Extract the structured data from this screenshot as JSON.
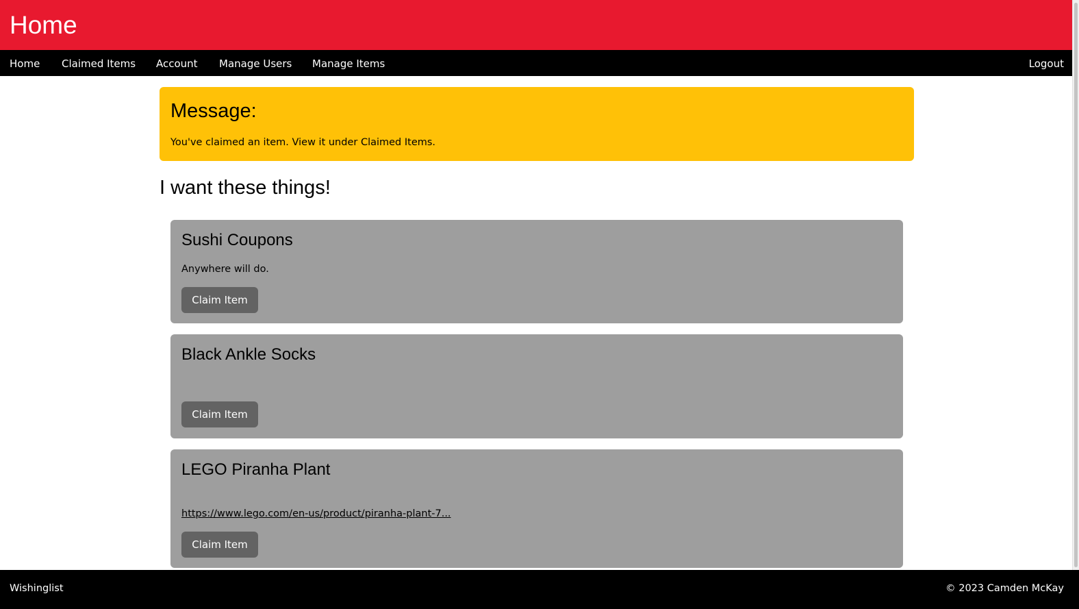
{
  "header": {
    "title": "Home"
  },
  "nav": {
    "items": [
      {
        "label": "Home"
      },
      {
        "label": "Claimed Items"
      },
      {
        "label": "Account"
      },
      {
        "label": "Manage Users"
      },
      {
        "label": "Manage Items"
      }
    ],
    "logout": "Logout"
  },
  "message": {
    "title": "Message:",
    "text": "You've claimed an item. View it under Claimed Items."
  },
  "main": {
    "heading": "I want these things!",
    "items": [
      {
        "title": "Sushi Coupons",
        "description": "Anywhere will do.",
        "link": "",
        "button": "Claim Item"
      },
      {
        "title": "Black Ankle Socks",
        "description": "",
        "link": "",
        "button": "Claim Item"
      },
      {
        "title": "LEGO Piranha Plant",
        "description": "",
        "link": "https://www.lego.com/en-us/product/piranha-plant-7...",
        "button": "Claim Item"
      }
    ]
  },
  "footer": {
    "left": "Wishinglist",
    "right": "© 2023 Camden McKay"
  },
  "colors": {
    "header_bg": "#e8192f",
    "nav_bg": "#000000",
    "message_bg": "#ffc107",
    "card_bg": "#9e9e9e",
    "button_bg": "#636363"
  }
}
